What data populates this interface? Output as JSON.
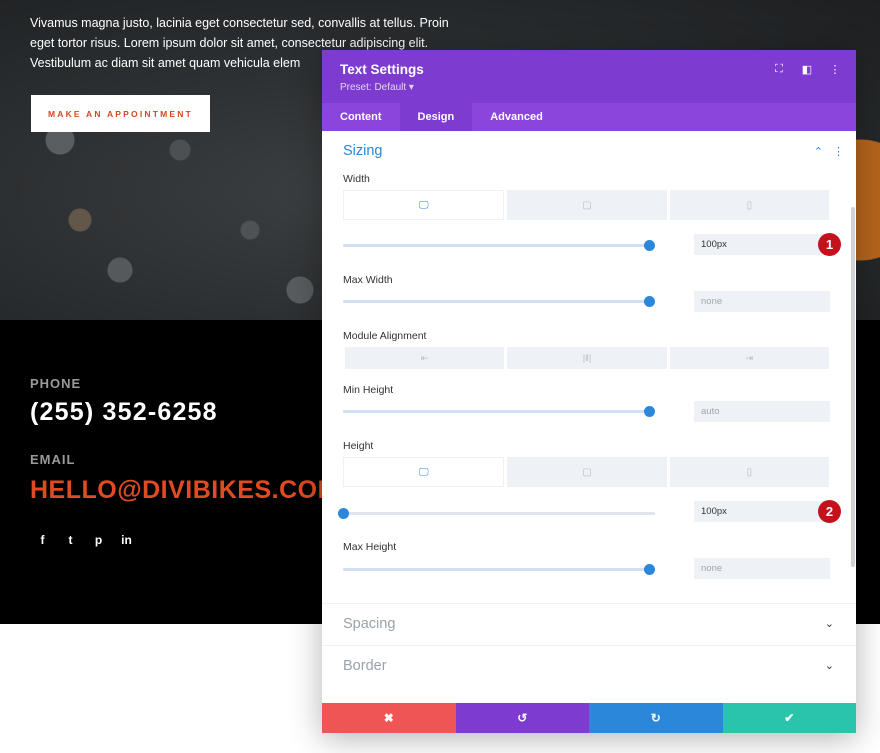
{
  "page": {
    "hero_text": "Vivamus magna justo, lacinia eget consectetur sed, convallis at tellus. Proin eget tortor risus. Lorem ipsum dolor sit amet, consectetur adipiscing elit. Vestibulum ac diam sit amet quam vehicula elem",
    "appointment_button": "MAKE AN APPOINTMENT",
    "phone_label": "PHONE",
    "phone": "(255) 352-6258",
    "email_label": "EMAIL",
    "email": "HELLO@DIVIBIKES.COM",
    "social_icons": [
      "facebook-icon",
      "twitter-icon",
      "pinterest-icon",
      "linkedin-icon"
    ],
    "social_glyphs": [
      "f",
      "t",
      "p",
      "in"
    ]
  },
  "modal": {
    "title": "Text Settings",
    "preset": "Preset: Default ▾",
    "header_icons": [
      "⛶",
      "◧",
      "⋮"
    ],
    "tabs": [
      "Content",
      "Design",
      "Advanced"
    ],
    "active_tab": "Design",
    "section": {
      "title": "Sizing",
      "chevron": "⌃",
      "menu": "⋮"
    },
    "width": {
      "label": "Width",
      "value": "100px",
      "slider": 1.0
    },
    "max_width": {
      "label": "Max Width",
      "placeholder": "none",
      "slider": 1.0
    },
    "module_alignment": {
      "label": "Module Alignment",
      "options": [
        "⇤",
        "|‖|",
        "⇥"
      ]
    },
    "min_height": {
      "label": "Min Height",
      "placeholder": "auto",
      "slider": 1.0
    },
    "height": {
      "label": "Height",
      "value": "100px",
      "slider": 0.0
    },
    "max_height": {
      "label": "Max Height",
      "placeholder": "none",
      "slider": 1.0
    },
    "device_icons": [
      "🖵",
      "▢",
      "▯"
    ],
    "collapsed_sections": [
      "Spacing",
      "Border"
    ],
    "collapsed_chevron": "⌄",
    "markers": [
      "1",
      "2"
    ],
    "footer": {
      "cancel": "✖",
      "undo": "↺",
      "redo": "↻",
      "save": "✔"
    }
  },
  "colors": {
    "accent_purple": "#7e3bd0",
    "accent_blue": "#2b87da",
    "brand_orange": "#e24a21",
    "cancel_red": "#ef5555",
    "save_green": "#29c4a9",
    "marker_red": "#c4121d"
  }
}
